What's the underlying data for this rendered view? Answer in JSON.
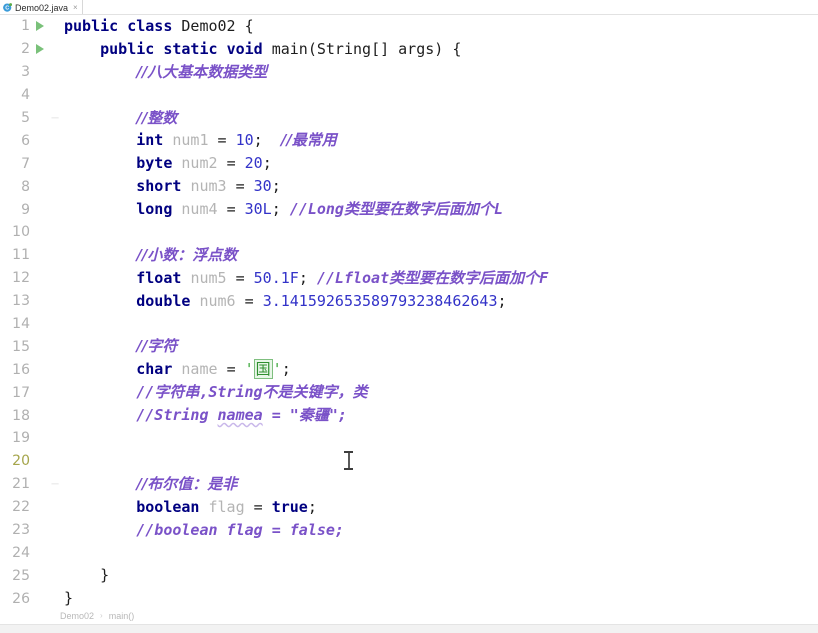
{
  "window": {
    "app": "IntelliJ IDEA Editor",
    "tab": {
      "icon": "java-class-icon",
      "label": "Demo02.java",
      "close": "×"
    }
  },
  "editor": {
    "current_line": 20,
    "total_lines": 26,
    "run_marker_lines": [
      1,
      2
    ],
    "colors": {
      "keyword": "#000080",
      "identifier": "#b4b4b4",
      "number": "#3232c8",
      "comment": "#7a52c8",
      "char_literal": "#2f8f2f",
      "line_number": "#b0b0b0",
      "current_line_number": "#a5a54b",
      "run_arrow": "#7ac17a",
      "background": "#ffffff"
    },
    "lines": [
      {
        "n": "1",
        "run": true,
        "fold": "",
        "text": "public class Demo02 {"
      },
      {
        "n": "2",
        "run": true,
        "fold": "",
        "text": "    public static void main(String[] args) {"
      },
      {
        "n": "3",
        "run": false,
        "fold": "",
        "text": "        //八大基本数据类型"
      },
      {
        "n": "4",
        "run": false,
        "fold": "",
        "text": ""
      },
      {
        "n": "5",
        "run": false,
        "fold": "─",
        "text": "        //整数"
      },
      {
        "n": "6",
        "run": false,
        "fold": "",
        "text": "        int num1 = 10;  //最常用"
      },
      {
        "n": "7",
        "run": false,
        "fold": "",
        "text": "        byte num2 = 20;"
      },
      {
        "n": "8",
        "run": false,
        "fold": "",
        "text": "        short num3 = 30;"
      },
      {
        "n": "9",
        "run": false,
        "fold": "",
        "text": "        long num4 = 30L; //Long类型要在数字后面加个L"
      },
      {
        "n": "10",
        "run": false,
        "fold": "",
        "text": ""
      },
      {
        "n": "11",
        "run": false,
        "fold": "",
        "text": "        //小数：浮点数"
      },
      {
        "n": "12",
        "run": false,
        "fold": "",
        "text": "        float num5 = 50.1F; //Lfloat类型要在数字后面加个F"
      },
      {
        "n": "13",
        "run": false,
        "fold": "",
        "text": "        double num6 = 3.141592653589793238462643;"
      },
      {
        "n": "14",
        "run": false,
        "fold": "",
        "text": ""
      },
      {
        "n": "15",
        "run": false,
        "fold": "",
        "text": "        //字符"
      },
      {
        "n": "16",
        "run": false,
        "fold": "",
        "text": "        char name = '国';"
      },
      {
        "n": "17",
        "run": false,
        "fold": "",
        "text": "        //字符串,String不是关键字，类"
      },
      {
        "n": "18",
        "run": false,
        "fold": "",
        "text": "        //String namea = \"秦疆\";"
      },
      {
        "n": "19",
        "run": false,
        "fold": "",
        "text": ""
      },
      {
        "n": "20",
        "run": false,
        "fold": "",
        "text": ""
      },
      {
        "n": "21",
        "run": false,
        "fold": "─",
        "text": "        //布尔值：是非"
      },
      {
        "n": "22",
        "run": false,
        "fold": "",
        "text": "        boolean flag = true;"
      },
      {
        "n": "23",
        "run": false,
        "fold": "",
        "text": "        //boolean flag = false;"
      },
      {
        "n": "24",
        "run": false,
        "fold": "",
        "text": ""
      },
      {
        "n": "25",
        "run": false,
        "fold": "",
        "text": "    }"
      },
      {
        "n": "26",
        "run": false,
        "fold": "",
        "text": "}"
      }
    ],
    "tokens": {
      "l1": {
        "kw1": "public",
        "kw2": "class",
        "id1": "Demo02",
        "brace": "{"
      },
      "l2": {
        "kw1": "public",
        "kw2": "static",
        "kw3": "void",
        "id1": "main",
        "p1": "(",
        "id2": "String",
        "p2": "[] ",
        "id3": "args",
        "p3": ") ",
        "brace": "{"
      },
      "l3": {
        "comment": "//八大基本数据类型"
      },
      "l5": {
        "comment": "//整数"
      },
      "l6": {
        "kw": "int",
        "id": "num1",
        "eq": "= ",
        "num": "10",
        "semi": ";",
        "comment": "//最常用"
      },
      "l7": {
        "kw": "byte",
        "id": "num2",
        "eq": "= ",
        "num": "20",
        "semi": ";"
      },
      "l8": {
        "kw": "short",
        "id": "num3",
        "eq": "= ",
        "num": "30",
        "semi": ";"
      },
      "l9": {
        "kw": "long",
        "id": "num4",
        "eq": "= ",
        "num": "30L",
        "semi": ";",
        "comment_latin": "//Long",
        "comment_cn": "类型要在数字后面加个",
        "comment_tail": "L"
      },
      "l11": {
        "comment": "//小数：浮点数"
      },
      "l12": {
        "kw": "float",
        "id": "num5",
        "eq": "= ",
        "num": "50.1F",
        "semi": ";",
        "comment_latin": "//Lfloat",
        "comment_cn": "类型要在数字后面加个",
        "comment_tail": "F"
      },
      "l13": {
        "kw": "double",
        "id": "num6",
        "eq": "= ",
        "num": "3.141592653589793238462643",
        "semi": ";"
      },
      "l15": {
        "comment": "//字符"
      },
      "l16": {
        "kw": "char",
        "id": "name",
        "eq": "= ",
        "q1": "'",
        "ch": "国",
        "q2": "'",
        "semi": ";"
      },
      "l17": {
        "comment_a": "//",
        "comment_cn1": "字符串",
        "comment_b": ",String",
        "comment_cn2": "不是关键字，类"
      },
      "l18": {
        "comment_a": "//String ",
        "comment_sq": "namea",
        "comment_b": " = \"",
        "comment_cn": "秦疆",
        "comment_c": "\";"
      },
      "l21": {
        "comment": "//布尔值：是非"
      },
      "l22": {
        "kw": "boolean",
        "id": "flag",
        "eq": "= ",
        "kw2": "true",
        "semi": ";"
      },
      "l23": {
        "comment": "//boolean flag = false;"
      },
      "l25": {
        "brace": "}"
      },
      "l26": {
        "brace": "}"
      }
    }
  },
  "breadcrumb": {
    "class": "Demo02",
    "separator": "›",
    "method": "main()"
  }
}
